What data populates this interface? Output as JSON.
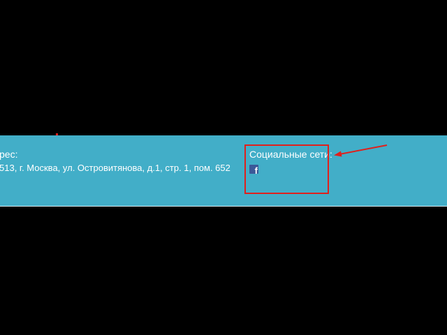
{
  "footer": {
    "address_heading": "рес:",
    "address_line": "513, г. Москва, ул. Островитянова, д.1, стр. 1, пом. 652",
    "social_heading": "Социальные сети:",
    "social_icons": [
      "facebook-icon"
    ]
  },
  "colors": {
    "footer_background": "#42aec8",
    "annotation_red": "#e0201c",
    "facebook_blue": "#3b5998",
    "page_background": "#000000"
  }
}
